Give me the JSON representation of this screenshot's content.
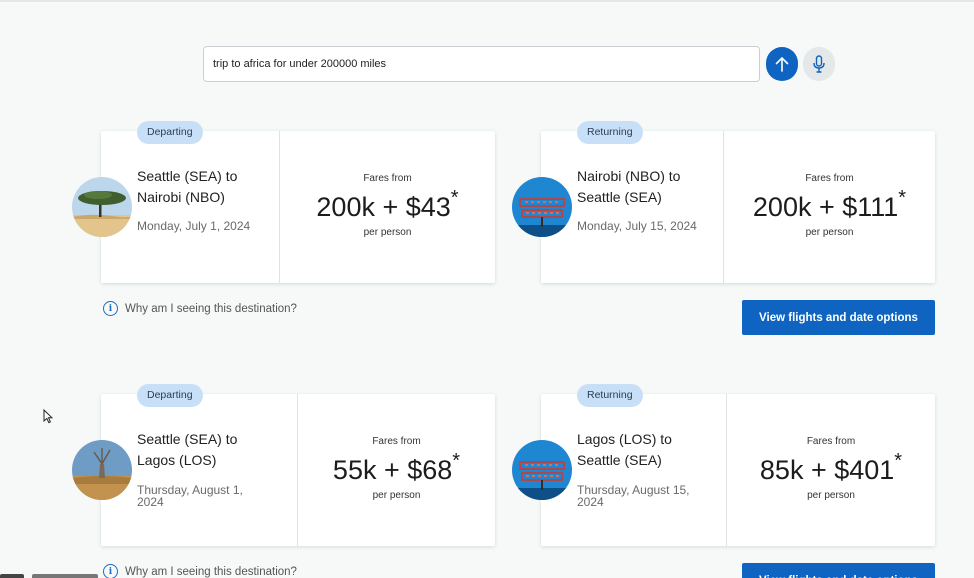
{
  "search": {
    "query": "trip to africa for under 200000 miles"
  },
  "trips": [
    {
      "departing": {
        "badge": "Departing",
        "route": "Seattle (SEA) to Nairobi (NBO)",
        "date": "Monday, July 1, 2024",
        "fares_from": "Fares from",
        "price": "200k + $43",
        "asterisk": "*",
        "per_person": "per person",
        "image": "acacia-tree-icon"
      },
      "returning": {
        "badge": "Returning",
        "route": "Nairobi (NBO) to Seattle (SEA)",
        "date": "Monday, July 15, 2024",
        "fares_from": "Fares from",
        "price": "200k + $111",
        "asterisk": "*",
        "per_person": "per person",
        "image": "public-market-sign-icon"
      },
      "why_text": "Why am I seeing this destination?",
      "view_button": "View flights and date options"
    },
    {
      "departing": {
        "badge": "Departing",
        "route": "Seattle (SEA) to Lagos (LOS)",
        "date": "Thursday, August 1, 2024",
        "fares_from": "Fares from",
        "price": "55k + $68",
        "asterisk": "*",
        "per_person": "per person",
        "image": "baobab-tree-icon"
      },
      "returning": {
        "badge": "Returning",
        "route": "Lagos (LOS) to Seattle (SEA)",
        "date": "Thursday, August 15, 2024",
        "fares_from": "Fares from",
        "price": "85k + $401",
        "asterisk": "*",
        "per_person": "per person",
        "image": "public-market-sign-icon"
      },
      "why_text": "Why am I seeing this destination?",
      "view_button": "View flights and date options"
    }
  ],
  "colors": {
    "primary": "#0e64c0",
    "badge_bg": "#c8e0f7",
    "background": "#f6f9f8"
  }
}
